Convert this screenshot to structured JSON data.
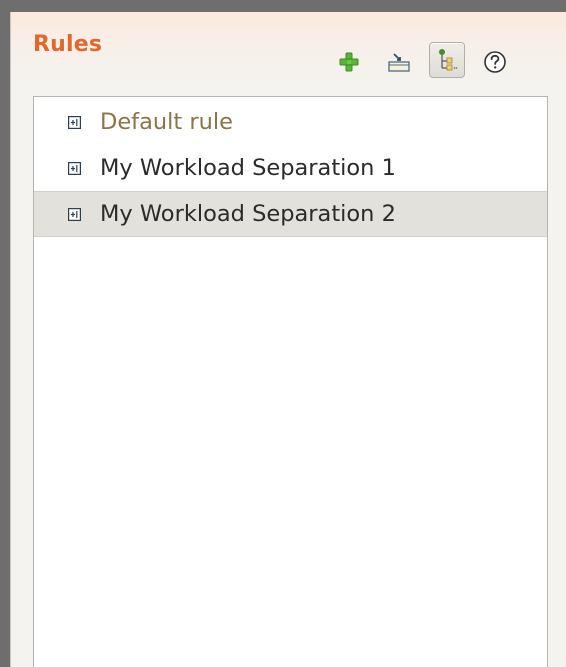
{
  "panel": {
    "title": "Rules"
  },
  "toolbar": {
    "buttons": [
      {
        "icon": "add-icon"
      },
      {
        "icon": "import-icon"
      },
      {
        "icon": "tree-hierarchy-icon",
        "active": true
      },
      {
        "icon": "help-icon"
      }
    ]
  },
  "rules": {
    "items": [
      {
        "label": "Default rule",
        "icon": "rule-icon",
        "style": "default"
      },
      {
        "label": "My Workload Separation 1",
        "icon": "rule-icon"
      },
      {
        "label": "My Workload Separation 2",
        "icon": "rule-icon",
        "selected": true
      }
    ]
  },
  "colors": {
    "title": "#e0682c",
    "default_rule_text": "#8c7446",
    "selected_row": "#e3e1dc",
    "add_icon_green": "#5bb33a"
  }
}
